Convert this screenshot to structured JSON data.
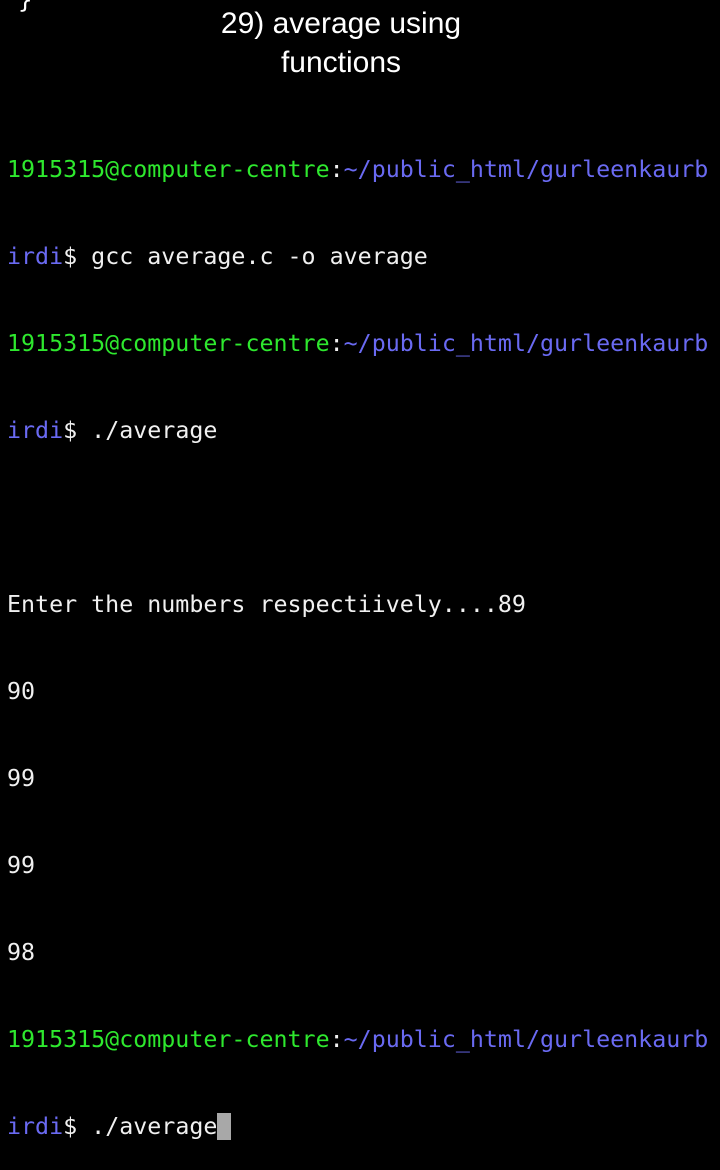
{
  "fragment": "}",
  "title": {
    "line1": "29) average using",
    "line2": "functions"
  },
  "prompt": {
    "user_host": "1915315@computer-centre",
    "colon": ":",
    "path_part1": "~/public_html/gurleenkaurb",
    "path_part2": "irdi",
    "symbol": "$"
  },
  "commands": [
    " gcc average.c -o average",
    " ./average",
    " ./average"
  ],
  "output": {
    "blank": "",
    "lines": [
      "Enter the numbers respectiively....89",
      "90",
      "99",
      "99",
      "98"
    ]
  },
  "colors": {
    "user_host": "#2ee82e",
    "path": "#6a6af2",
    "text": "#f0f0f0",
    "cursor": "#a8a8a8"
  }
}
